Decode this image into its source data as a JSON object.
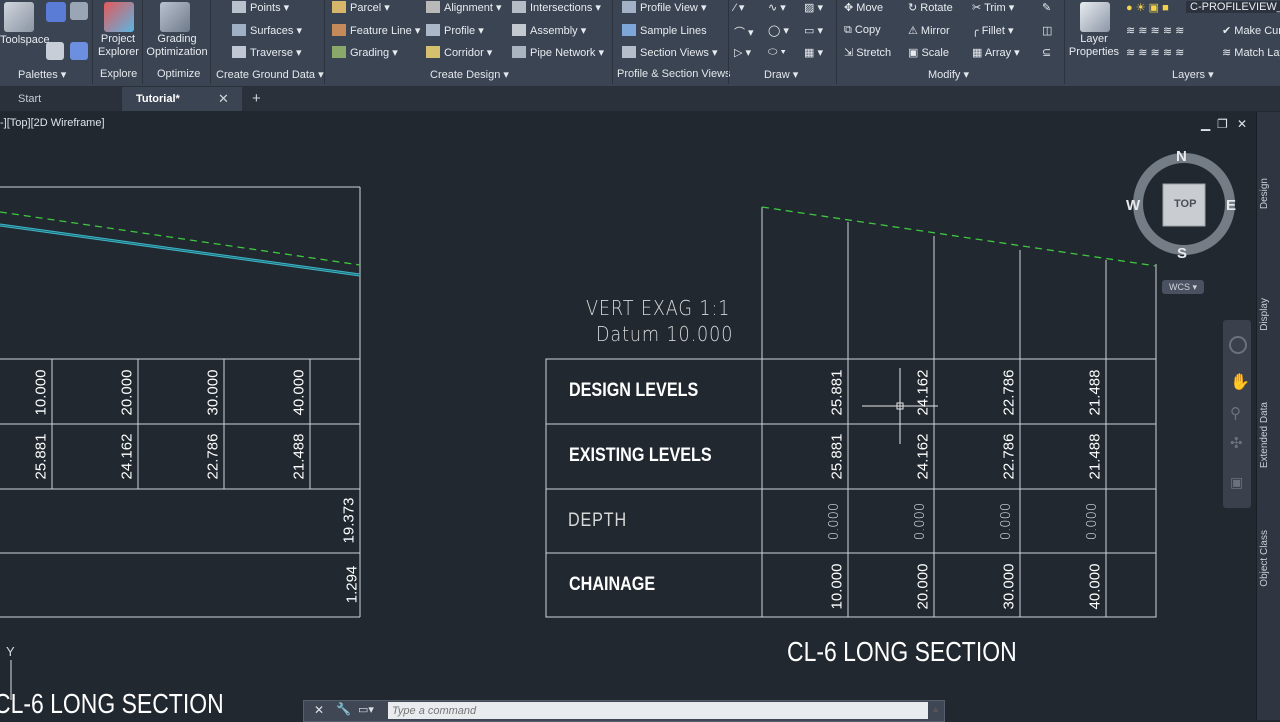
{
  "ribbon": {
    "palettes_group": {
      "toolspace": "Toolspace",
      "title": "Palettes"
    },
    "explore_group": {
      "project_explorer": "Project Explorer",
      "title": "Explore"
    },
    "optimize_group": {
      "grading_optimization": "Grading Optimization",
      "title": "Optimize"
    },
    "create_ground": {
      "points": "Points",
      "surfaces": "Surfaces",
      "traverse": "Traverse",
      "title": "Create Ground Data"
    },
    "create_design": {
      "parcel": "Parcel",
      "feature_line": "Feature Line",
      "grading": "Grading",
      "alignment": "Alignment",
      "profile": "Profile",
      "corridor": "Corridor",
      "intersections": "Intersections",
      "assembly": "Assembly",
      "pipe_network": "Pipe Network",
      "title": "Create Design"
    },
    "profile_section": {
      "profile_view": "Profile View",
      "sample_lines": "Sample Lines",
      "section_views": "Section Views",
      "title": "Profile & Section Views"
    },
    "draw": {
      "title": "Draw"
    },
    "modify": {
      "move": "Move",
      "rotate": "Rotate",
      "trim": "Trim",
      "copy": "Copy",
      "mirror": "Mirror",
      "fillet": "Fillet",
      "stretch": "Stretch",
      "scale": "Scale",
      "array": "Array",
      "title": "Modify"
    },
    "layers": {
      "layer_properties": "Layer Properties",
      "current_layer": "C-PROFILEVIEW_T",
      "make_current": "Make Cur",
      "match_layer": "Match Lay",
      "title": "Layers"
    }
  },
  "tabs": [
    {
      "label": "Start"
    },
    {
      "label": "Tutorial*"
    }
  ],
  "viewport": {
    "label": "-][Top][2D Wireframe]",
    "nav": {
      "n": "N",
      "s": "S",
      "e": "E",
      "w": "W",
      "face": "TOP",
      "wcs": "WCS"
    }
  },
  "right_panel": [
    "Design",
    "Display",
    "Extended Data",
    "Object Class"
  ],
  "left_section": {
    "chainage": [
      "10.000",
      "20.000",
      "30.000",
      "40.000"
    ],
    "existing": [
      "25.881",
      "24.162",
      "22.786",
      "21.488"
    ],
    "extra1": "19.373",
    "extra2": "1.294",
    "title": "CL-6 LONG SECTION"
  },
  "right_section": {
    "vert_exag": "VERT EXAG 1:1",
    "datum": "Datum 10.000",
    "row_labels": {
      "design": "DESIGN LEVELS",
      "existing": "EXISTING LEVELS",
      "depth": "DEPTH",
      "chainage": "CHAINAGE"
    },
    "design": [
      "25.881",
      "24.162",
      "22.786",
      "21.488"
    ],
    "existing": [
      "25.881",
      "24.162",
      "22.786",
      "21.488"
    ],
    "depth": [
      "0.000",
      "0.000",
      "0.000",
      "0.000"
    ],
    "chainage": [
      "10.000",
      "20.000",
      "30.000",
      "40.000"
    ],
    "title": "CL-6 LONG SECTION"
  },
  "ucs_label": "Y",
  "command": {
    "placeholder": "Type a command"
  },
  "colors": {
    "ribbon": "#3b4453",
    "canvas": "#212830",
    "design_line": "#3ec83e",
    "existing_line": "#3fb6c8"
  }
}
